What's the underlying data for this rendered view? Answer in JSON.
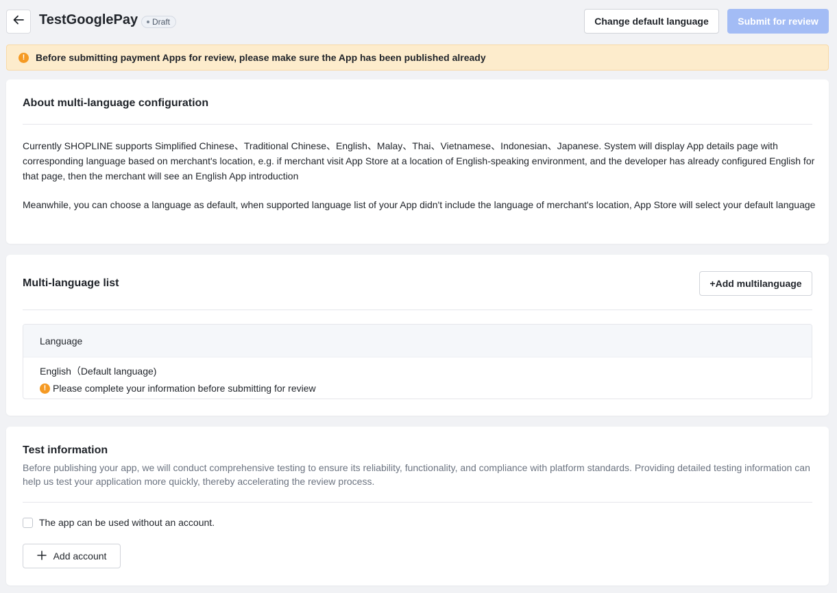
{
  "header": {
    "app_name": "TestGooglePay",
    "status": "Draft",
    "change_language_label": "Change default language",
    "submit_label": "Submit for review"
  },
  "alert": {
    "text": "Before submitting payment Apps for review, please make sure the App has been published already"
  },
  "about": {
    "title": "About multi-language configuration",
    "paragraph1": "Currently SHOPLINE supports Simplified Chinese、Traditional Chinese、English、Malay、Thai、Vietnamese、Indonesian、Japanese. System will display App details page with corresponding language based on merchant's location, e.g. if merchant visit App Store at a location of English-speaking environment, and the developer has already configured English for that page, then the merchant will see an English App introduction",
    "paragraph2": "Meanwhile, you can choose a language as default, when supported language list of your App didn't include the language of merchant's location, App Store will select your default language"
  },
  "multilang": {
    "title": "Multi-language list",
    "add_label": "+Add multilanguage",
    "column_header": "Language",
    "rows": [
      {
        "language": "English（Default language)",
        "warning": "Please complete your information before submitting for review"
      }
    ]
  },
  "test_info": {
    "title": "Test information",
    "description": "Before publishing your app, we will conduct comprehensive testing to ensure its reliability, functionality, and compliance with platform standards. Providing detailed testing information can help us test your application more quickly, thereby accelerating the review process.",
    "checkbox_label": "The app can be used without an account.",
    "add_account_label": "Add account"
  },
  "icons": {
    "back": "arrow-left-icon",
    "warning": "exclamation-circle-icon",
    "plus": "plus-icon"
  },
  "colors": {
    "page_bg": "#f1f2f5",
    "alert_bg": "#fdeccc",
    "warning": "#f59a23",
    "primary_disabled": "#a3bcf5"
  }
}
